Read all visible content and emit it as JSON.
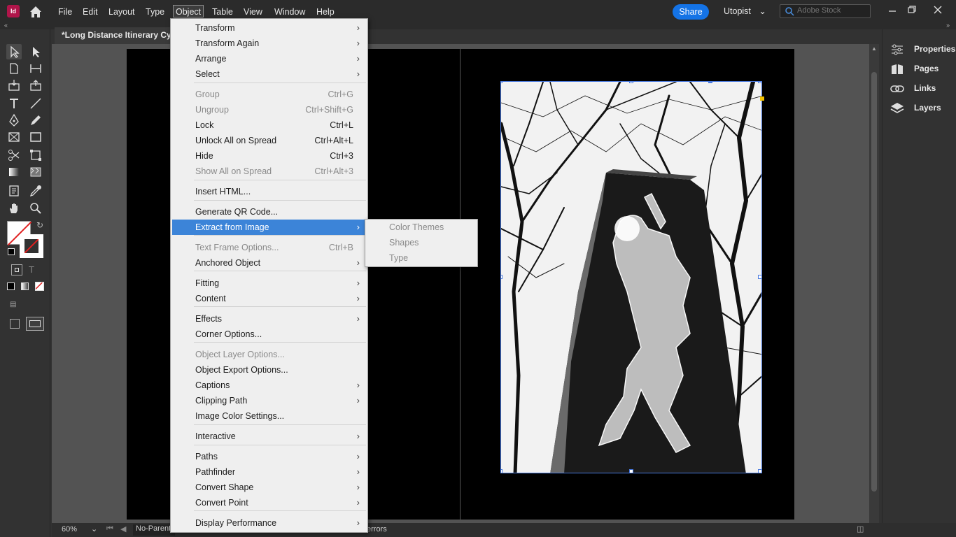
{
  "app": {
    "logo_text": "Id",
    "menu": [
      "File",
      "Edit",
      "Layout",
      "Type",
      "Object",
      "Table",
      "View",
      "Window",
      "Help"
    ],
    "active_menu": "Object",
    "share_label": "Share",
    "workspace_label": "Utopist",
    "stock_search_placeholder": "Adobe Stock"
  },
  "document": {
    "tab_title": "*Long Distance Itinerary Cyclis"
  },
  "right_panels": [
    {
      "label": "Properties",
      "icon": "properties-icon"
    },
    {
      "label": "Pages",
      "icon": "pages-icon"
    },
    {
      "label": "Links",
      "icon": "links-icon"
    },
    {
      "label": "Layers",
      "icon": "layers-icon"
    }
  ],
  "status": {
    "zoom": "60%",
    "parent_style": "No-Parent",
    "errors_label": "errors"
  },
  "object_menu": {
    "items": [
      {
        "label": "Transform",
        "shortcut": "",
        "submenu": true,
        "disabled": false
      },
      {
        "label": "Transform Again",
        "shortcut": "",
        "submenu": true,
        "disabled": false
      },
      {
        "label": "Arrange",
        "shortcut": "",
        "submenu": true,
        "disabled": false
      },
      {
        "label": "Select",
        "shortcut": "",
        "submenu": true,
        "disabled": false
      },
      {
        "label": "Group",
        "shortcut": "Ctrl+G",
        "submenu": false,
        "disabled": true
      },
      {
        "label": "Ungroup",
        "shortcut": "Ctrl+Shift+G",
        "submenu": false,
        "disabled": true
      },
      {
        "label": "Lock",
        "shortcut": "Ctrl+L",
        "submenu": false,
        "disabled": false
      },
      {
        "label": "Unlock All on Spread",
        "shortcut": "Ctrl+Alt+L",
        "submenu": false,
        "disabled": false
      },
      {
        "label": "Hide",
        "shortcut": "Ctrl+3",
        "submenu": false,
        "disabled": false
      },
      {
        "label": "Show All on Spread",
        "shortcut": "Ctrl+Alt+3",
        "submenu": false,
        "disabled": true
      },
      {
        "label": "Insert HTML...",
        "shortcut": "",
        "submenu": false,
        "disabled": false
      },
      {
        "label": "Generate QR Code...",
        "shortcut": "",
        "submenu": false,
        "disabled": false
      },
      {
        "label": "Extract from Image",
        "shortcut": "",
        "submenu": true,
        "disabled": false,
        "highlighted": true
      },
      {
        "label": "Text Frame Options...",
        "shortcut": "Ctrl+B",
        "submenu": false,
        "disabled": true
      },
      {
        "label": "Anchored Object",
        "shortcut": "",
        "submenu": true,
        "disabled": false
      },
      {
        "label": "Fitting",
        "shortcut": "",
        "submenu": true,
        "disabled": false
      },
      {
        "label": "Content",
        "shortcut": "",
        "submenu": true,
        "disabled": false
      },
      {
        "label": "Effects",
        "shortcut": "",
        "submenu": true,
        "disabled": false
      },
      {
        "label": "Corner Options...",
        "shortcut": "",
        "submenu": false,
        "disabled": false
      },
      {
        "label": "Object Layer Options...",
        "shortcut": "",
        "submenu": false,
        "disabled": true
      },
      {
        "label": "Object Export Options...",
        "shortcut": "",
        "submenu": false,
        "disabled": false
      },
      {
        "label": "Captions",
        "shortcut": "",
        "submenu": true,
        "disabled": false
      },
      {
        "label": "Clipping Path",
        "shortcut": "",
        "submenu": true,
        "disabled": false
      },
      {
        "label": "Image Color Settings...",
        "shortcut": "",
        "submenu": false,
        "disabled": false
      },
      {
        "label": "Interactive",
        "shortcut": "",
        "submenu": true,
        "disabled": false
      },
      {
        "label": "Paths",
        "shortcut": "",
        "submenu": true,
        "disabled": false
      },
      {
        "label": "Pathfinder",
        "shortcut": "",
        "submenu": true,
        "disabled": false
      },
      {
        "label": "Convert Shape",
        "shortcut": "",
        "submenu": true,
        "disabled": false
      },
      {
        "label": "Convert Point",
        "shortcut": "",
        "submenu": true,
        "disabled": false
      },
      {
        "label": "Display Performance",
        "shortcut": "",
        "submenu": true,
        "disabled": false
      }
    ]
  },
  "extract_submenu": {
    "items": [
      "Color Themes",
      "Shapes",
      "Type"
    ]
  },
  "colors": {
    "accent": "#1473e6",
    "menu_highlight": "#3c84d8",
    "brand": "#b0154a"
  }
}
